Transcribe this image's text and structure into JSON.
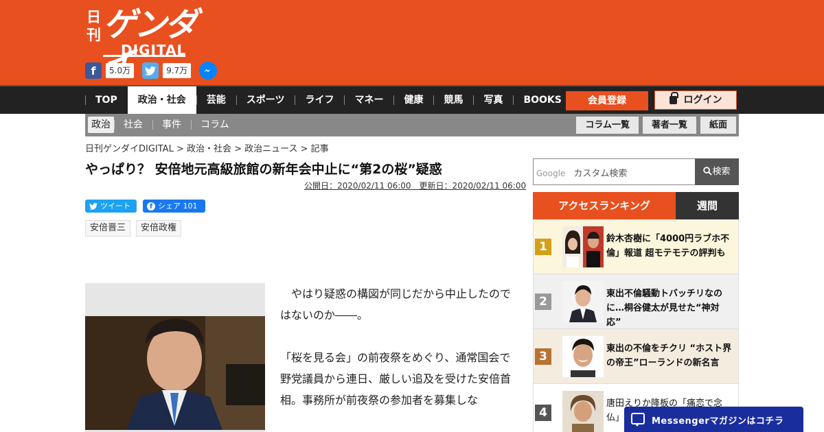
{
  "header": {
    "logo_kan": "日刊",
    "logo_main": "ゲンダイ",
    "logo_sub": "DIGITAL",
    "facebook_count": "5.0万",
    "twitter_count": "9.7万"
  },
  "nav": {
    "items": [
      "TOP",
      "政治・社会",
      "芸能",
      "スポーツ",
      "ライフ",
      "マネー",
      "健康",
      "競馬",
      "写真",
      "BOOKS"
    ],
    "active_index": 1,
    "register_label": "会員登録",
    "login_label": "ログイン"
  },
  "subnav": {
    "items": [
      "政治",
      "社会",
      "事件",
      "コラム"
    ],
    "buttons": [
      "コラム一覧",
      "著者一覧",
      "紙面"
    ]
  },
  "breadcrumb": "日刊ゲンダイDIGITAL > 政治・社会 > 政治ニュース > 記事",
  "article": {
    "title": "やっぱり？ 安倍地元高級旅館の新年会中止に“第2の桜”疑惑",
    "dates": "公開日：2020/02/11 06:00　更新日：2020/02/11 06:00",
    "tweet_label": "ツイート",
    "share_label": "シェア 101",
    "tags": [
      "安倍晋三",
      "安倍政権"
    ],
    "paragraphs": [
      "　やはり疑惑の構図が同じだから中止したのではないのか――。",
      "「桜を見る会」の前夜祭をめぐり、通常国会で野党議員から連日、厳しい追及を受けた安倍首相。事務所が前夜祭の参加者を募集しな"
    ]
  },
  "sidebar": {
    "search_brand": "Google",
    "search_placeholder": "カスタム検索",
    "search_button": "検索",
    "ranking_tab": "アクセスランキング",
    "weekly_tab": "週間",
    "rankings": [
      {
        "num": "1",
        "title": "鈴木杏樹に「4000円ラブホ不倫」報道 超モテモテの評判も",
        "color": "#d4a017"
      },
      {
        "num": "2",
        "title": "東出不倫騒動トバッチリなのに…桐谷健太が見せた“神対応”",
        "color": "#999999"
      },
      {
        "num": "3",
        "title": "東出の不倫をチクリ “ホスト界の帝王”ローランドの新名言",
        "color": "#b87333"
      },
      {
        "num": "4",
        "title": "唐田えりか降板の「痛恋で念仏」",
        "color": "#555555"
      }
    ]
  },
  "messenger_bar": "Messengerマガジンはコチラ"
}
